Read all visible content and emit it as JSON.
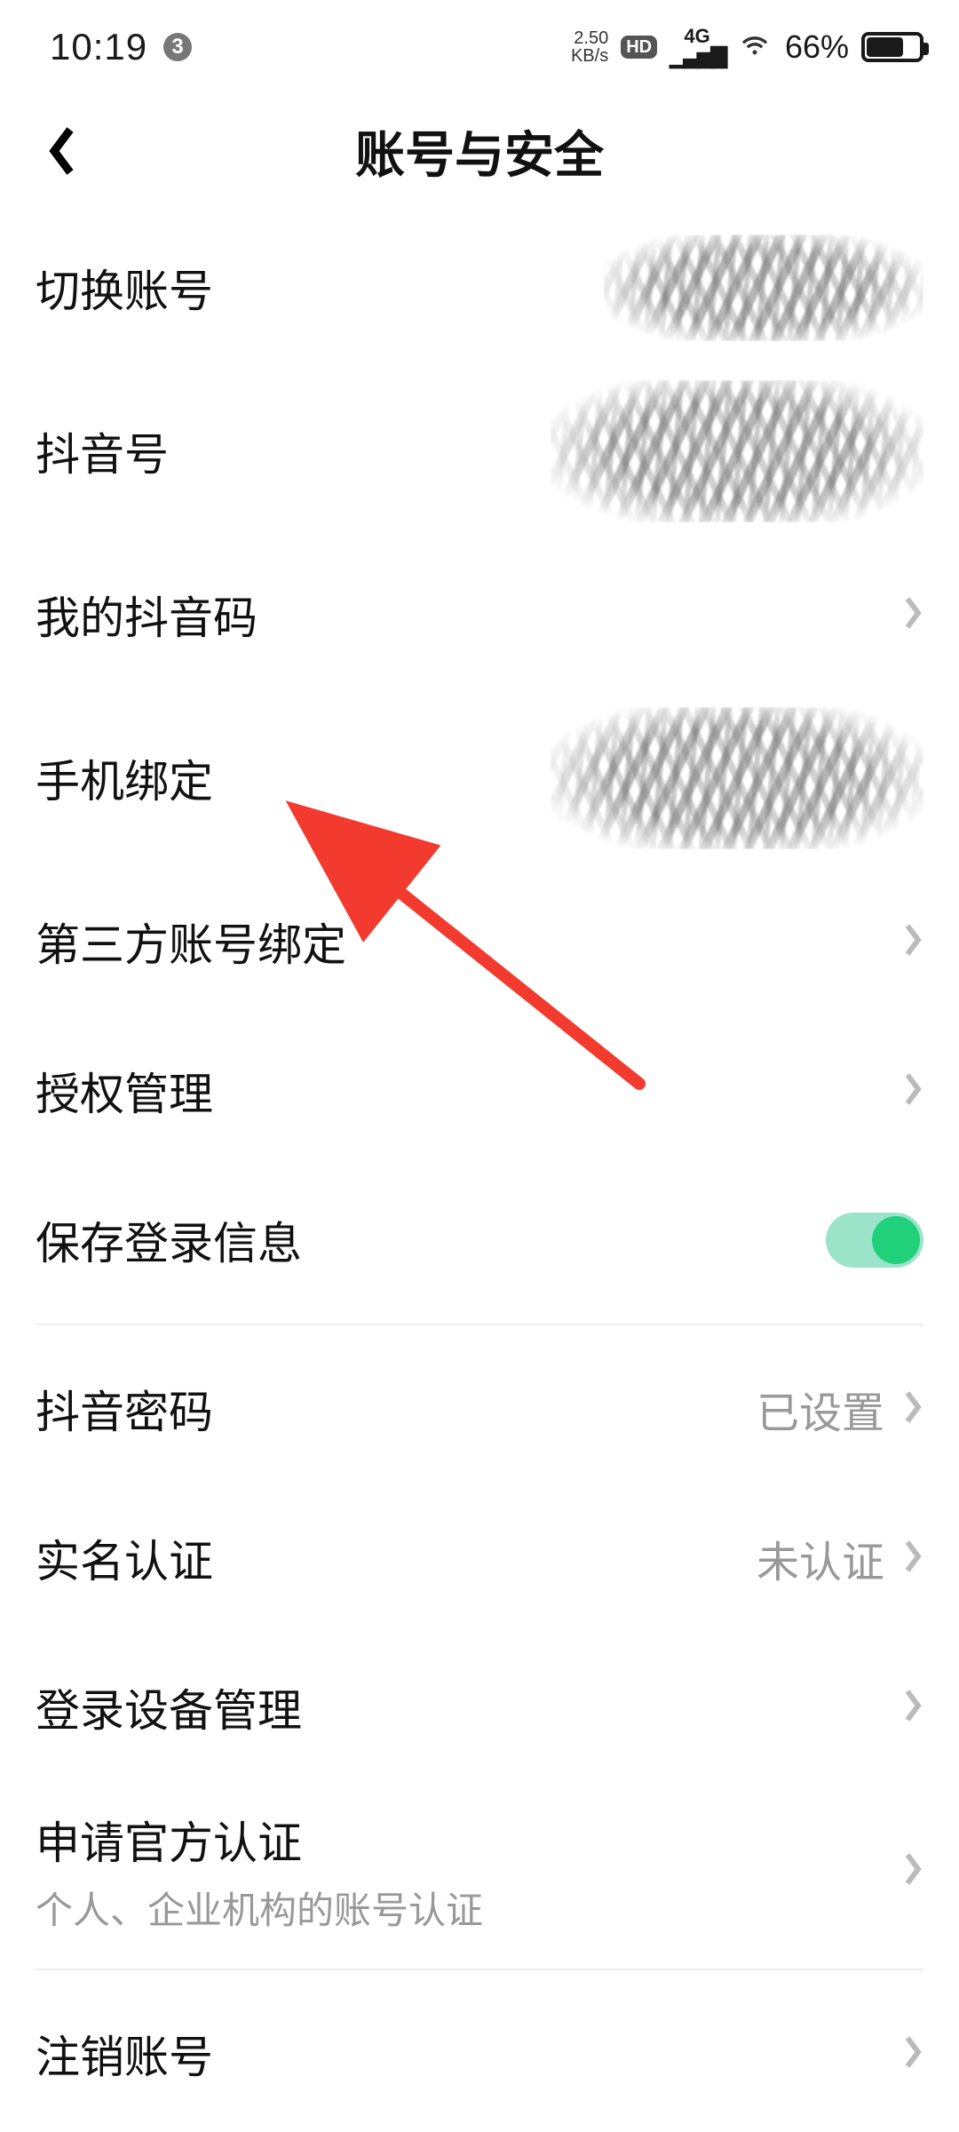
{
  "status_bar": {
    "time": "10:19",
    "notif_count": "3",
    "net_rate_top": "2.50",
    "net_rate_bottom": "KB/s",
    "hd_label": "HD",
    "net_type": "4G",
    "battery_pct": "66%"
  },
  "header": {
    "title": "账号与安全"
  },
  "rows": {
    "switch_account": {
      "label": "切换账号"
    },
    "douyin_id": {
      "label": "抖音号"
    },
    "my_qr": {
      "label": "我的抖音码"
    },
    "phone_bind": {
      "label": "手机绑定"
    },
    "third_party": {
      "label": "第三方账号绑定"
    },
    "auth_mgmt": {
      "label": "授权管理"
    },
    "save_login": {
      "label": "保存登录信息"
    },
    "password": {
      "label": "抖音密码",
      "value": "已设置"
    },
    "real_name": {
      "label": "实名认证",
      "value": "未认证"
    },
    "devices": {
      "label": "登录设备管理"
    },
    "official_cert": {
      "label": "申请官方认证",
      "sub": "个人、企业机构的账号认证"
    },
    "delete_acct": {
      "label": "注销账号"
    }
  }
}
